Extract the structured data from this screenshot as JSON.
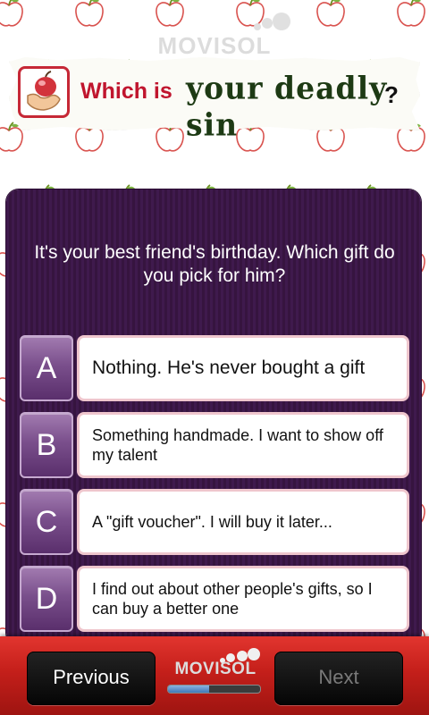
{
  "header": {
    "watermark": "MOVISOL",
    "title_part1": "Which is",
    "title_part2": "your deadly sin",
    "title_mark": "?",
    "icon": "apple-in-hand-icon"
  },
  "quiz": {
    "question": "It's your best friend's birthday. Which gift do you pick for him?",
    "options": [
      {
        "letter": "A",
        "text": "Nothing. He's never bought a gift"
      },
      {
        "letter": "B",
        "text": "Something handmade. I want to show off my talent"
      },
      {
        "letter": "C",
        "text": "A \"gift voucher\". I will buy it later..."
      },
      {
        "letter": "D",
        "text": "I find out about other people's gifts, so I can buy a better one"
      }
    ]
  },
  "footer": {
    "previous_label": "Previous",
    "next_label": "Next",
    "brand": "MOVISOL",
    "progress_fraction": 0.45
  },
  "colors": {
    "panel": "#3f1a4d",
    "accent_red": "#c0152e",
    "option_letter": "#7a4f8c",
    "bottom_bar": "#c41f1a"
  }
}
